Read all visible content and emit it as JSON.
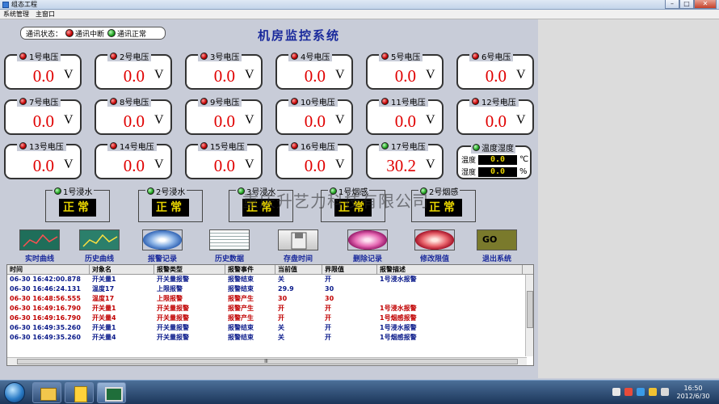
{
  "window": {
    "title": "组态工程",
    "buttons": [
      "–",
      "□",
      "✕"
    ]
  },
  "menu": [
    "系统管理",
    "主窗口"
  ],
  "comm_status": {
    "label": "通讯状态：",
    "fault": "通讯中断",
    "ok": "通讯正常"
  },
  "system_title": "机房监控系统",
  "voltages": [
    {
      "label": "1号电压",
      "value": "0.0",
      "unit": "V",
      "led": "red"
    },
    {
      "label": "2号电压",
      "value": "0.0",
      "unit": "V",
      "led": "red"
    },
    {
      "label": "3号电压",
      "value": "0.0",
      "unit": "V",
      "led": "red"
    },
    {
      "label": "4号电压",
      "value": "0.0",
      "unit": "V",
      "led": "red"
    },
    {
      "label": "5号电压",
      "value": "0.0",
      "unit": "V",
      "led": "red"
    },
    {
      "label": "6号电压",
      "value": "0.0",
      "unit": "V",
      "led": "red"
    },
    {
      "label": "7号电压",
      "value": "0.0",
      "unit": "V",
      "led": "red"
    },
    {
      "label": "8号电压",
      "value": "0.0",
      "unit": "V",
      "led": "red"
    },
    {
      "label": "9号电压",
      "value": "0.0",
      "unit": "V",
      "led": "red"
    },
    {
      "label": "10号电压",
      "value": "0.0",
      "unit": "V",
      "led": "red"
    },
    {
      "label": "11号电压",
      "value": "0.0",
      "unit": "V",
      "led": "red"
    },
    {
      "label": "12号电压",
      "value": "0.0",
      "unit": "V",
      "led": "red"
    },
    {
      "label": "13号电压",
      "value": "0.0",
      "unit": "V",
      "led": "red"
    },
    {
      "label": "14号电压",
      "value": "0.0",
      "unit": "V",
      "led": "red"
    },
    {
      "label": "15号电压",
      "value": "0.0",
      "unit": "V",
      "led": "red"
    },
    {
      "label": "16号电压",
      "value": "0.0",
      "unit": "V",
      "led": "red"
    },
    {
      "label": "17号电压",
      "value": "30.2",
      "unit": "V",
      "led": "green"
    }
  ],
  "temp_humidity": {
    "title": "温度湿度",
    "temp_label": "温度",
    "temp_value": "0.0",
    "temp_unit": "℃",
    "hum_label": "湿度",
    "hum_value": "0.0",
    "hum_unit": "%"
  },
  "sensors": [
    {
      "label": "1号浸水",
      "state": "正常",
      "led": "green"
    },
    {
      "label": "2号浸水",
      "state": "正常",
      "led": "green"
    },
    {
      "label": "3号浸水",
      "state": "正常",
      "led": "green"
    },
    {
      "label": "1号烟感",
      "state": "正常",
      "led": "green"
    },
    {
      "label": "2号烟感",
      "state": "正常",
      "led": "green"
    }
  ],
  "watermark": "重庆升艺力科技有限公司",
  "toolbar": [
    {
      "label": "实时曲线",
      "icon": "realtime-curve-icon"
    },
    {
      "label": "历史曲线",
      "icon": "history-curve-icon"
    },
    {
      "label": "报警记录",
      "icon": "alarm-record-icon"
    },
    {
      "label": "历史数据",
      "icon": "history-data-icon"
    },
    {
      "label": "存盘时间",
      "icon": "save-time-icon"
    },
    {
      "label": "删除记录",
      "icon": "delete-record-icon"
    },
    {
      "label": "修改限值",
      "icon": "modify-limit-icon"
    },
    {
      "label": "退出系统",
      "icon": "exit-icon",
      "icon_text": "GO"
    }
  ],
  "alarm_table": {
    "headers": [
      "时间",
      "对象名",
      "报警类型",
      "报警事件",
      "当前值",
      "界限值",
      "报警描述"
    ],
    "rows": [
      {
        "color": "blue",
        "cells": [
          "06-30 16:42:00.878",
          "开关量1",
          "开关量报警",
          "报警结束",
          "关",
          "开",
          "1号浸水报警"
        ]
      },
      {
        "color": "blue",
        "cells": [
          "06-30 16:46:24.131",
          "温度17",
          "上限报警",
          "报警结束",
          "29.9",
          "30",
          ""
        ]
      },
      {
        "color": "red",
        "cells": [
          "06-30 16:48:56.555",
          "温度17",
          "上限报警",
          "报警产生",
          "30",
          "30",
          ""
        ]
      },
      {
        "color": "red",
        "cells": [
          "06-30 16:49:16.790",
          "开关量1",
          "开关量报警",
          "报警产生",
          "开",
          "开",
          "1号浸水报警"
        ]
      },
      {
        "color": "red",
        "cells": [
          "06-30 16:49:16.790",
          "开关量4",
          "开关量报警",
          "报警产生",
          "开",
          "开",
          "1号烟感报警"
        ]
      },
      {
        "color": "blue",
        "cells": [
          "06-30 16:49:35.260",
          "开关量1",
          "开关量报警",
          "报警结束",
          "关",
          "开",
          "1号浸水报警"
        ]
      },
      {
        "color": "blue",
        "cells": [
          "06-30 16:49:35.260",
          "开关量4",
          "开关量报警",
          "报警结束",
          "关",
          "开",
          "1号烟感报警"
        ]
      }
    ],
    "scroll_mark": "Ⅲ"
  },
  "taskbar": {
    "clock_time": "16:50",
    "clock_date": "2012/6/30"
  }
}
